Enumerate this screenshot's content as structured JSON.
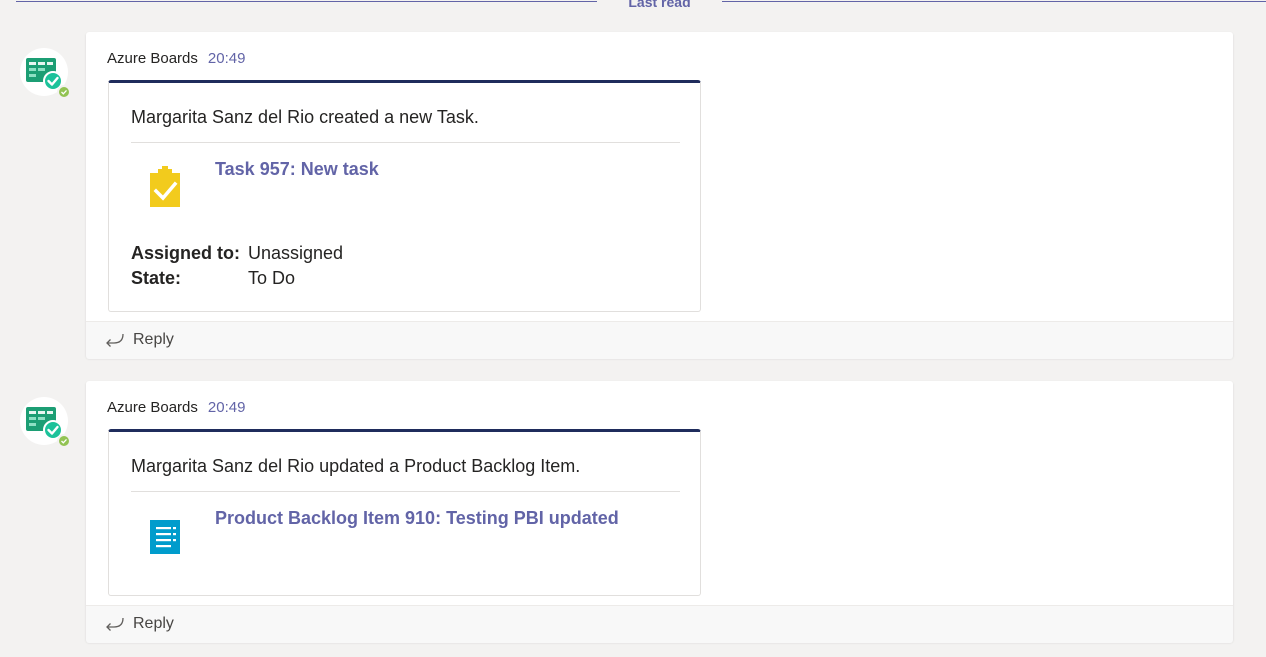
{
  "divider": {
    "label": "Last read"
  },
  "messages": [
    {
      "sender": "Azure Boards",
      "time": "20:49",
      "card": {
        "text": "Margarita Sanz del Rio created a new Task.",
        "link": "Task 957: New task",
        "icon": "task-clipboard-icon",
        "icon_color": "#f2cb1d",
        "facts": [
          {
            "title": "Assigned to:",
            "value": "Unassigned"
          },
          {
            "title": "State:",
            "value": "To Do"
          }
        ]
      },
      "reply_label": "Reply"
    },
    {
      "sender": "Azure Boards",
      "time": "20:49",
      "card": {
        "text": "Margarita Sanz del Rio updated a Product Backlog Item.",
        "link": "Product Backlog Item 910: Testing PBI updated",
        "icon": "backlog-item-icon",
        "icon_color": "#009ccc",
        "facts": []
      },
      "reply_label": "Reply"
    }
  ],
  "colors": {
    "accent": "#6264a7",
    "card_top_border": "#1f2c5c",
    "presence_available": "#92c353",
    "boards_logo": "#1c9e74"
  }
}
